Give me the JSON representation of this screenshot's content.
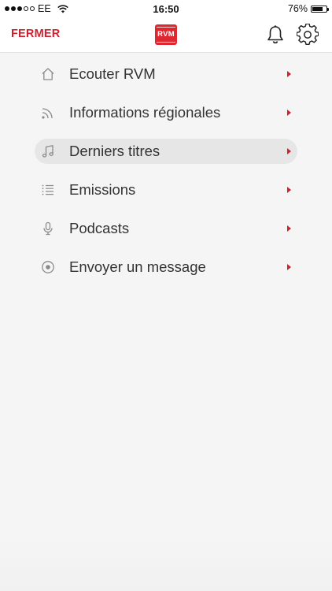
{
  "status_bar": {
    "carrier": "EE",
    "time": "16:50",
    "battery_percent": "76%",
    "battery_level": 0.76,
    "signal_bars_filled": 3,
    "signal_bars_total": 5
  },
  "header": {
    "close_label": "FERMER",
    "logo_text": "RVM",
    "bell_icon": "bell-icon",
    "gear_icon": "gear-icon"
  },
  "menu": {
    "items": [
      {
        "label": "Ecouter RVM",
        "icon": "home-icon",
        "active": false
      },
      {
        "label": "Informations régionales",
        "icon": "rss-icon",
        "active": false
      },
      {
        "label": "Derniers titres",
        "icon": "music-note-icon",
        "active": true
      },
      {
        "label": "Emissions",
        "icon": "list-icon",
        "active": false
      },
      {
        "label": "Podcasts",
        "icon": "microphone-icon",
        "active": false
      },
      {
        "label": "Envoyer un message",
        "icon": "record-icon",
        "active": false
      }
    ]
  },
  "colors": {
    "accent": "#d0202e",
    "logo": "#e0262f",
    "active_row": "#e6e6e6",
    "background": "#f5f5f5"
  }
}
